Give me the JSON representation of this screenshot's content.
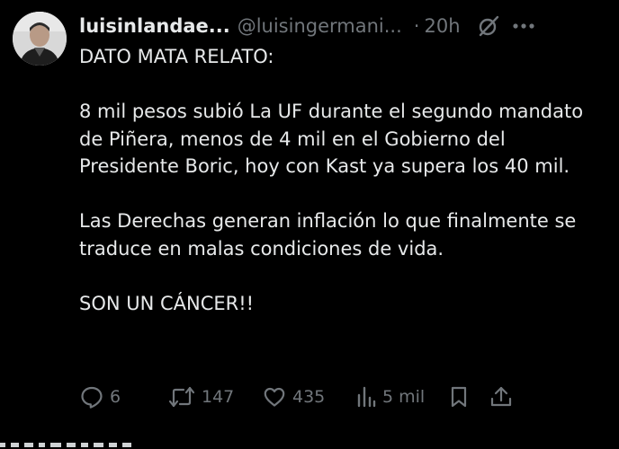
{
  "tweet": {
    "display_name": "luisinlandae...",
    "handle": "@luisingermani...",
    "separator": "·",
    "time": "20h",
    "paragraphs": [
      "DATO MATA RELATO:",
      "8 mil pesos subió La UF durante el segundo mandato de Piñera, menos de 4 mil en el Gobierno del Presidente Boric, hoy con Kast ya supera los 40 mil.",
      "Las Derechas generan inflación lo que finalmente se traduce en malas condiciones de vida.",
      "SON UN CÁNCER!!"
    ],
    "actions": {
      "replies": "6",
      "reposts": "147",
      "likes": "435",
      "views": "5 mil"
    }
  },
  "icons": {
    "avatar": "user-avatar",
    "grok": "grok-icon",
    "more": "more-icon",
    "reply": "reply-icon",
    "repost": "repost-icon",
    "like": "like-icon",
    "views": "views-icon",
    "bookmark": "bookmark-icon",
    "share": "share-icon"
  },
  "colors": {
    "background": "#000000",
    "text": "#e7e9ea",
    "secondary": "#71767b"
  }
}
